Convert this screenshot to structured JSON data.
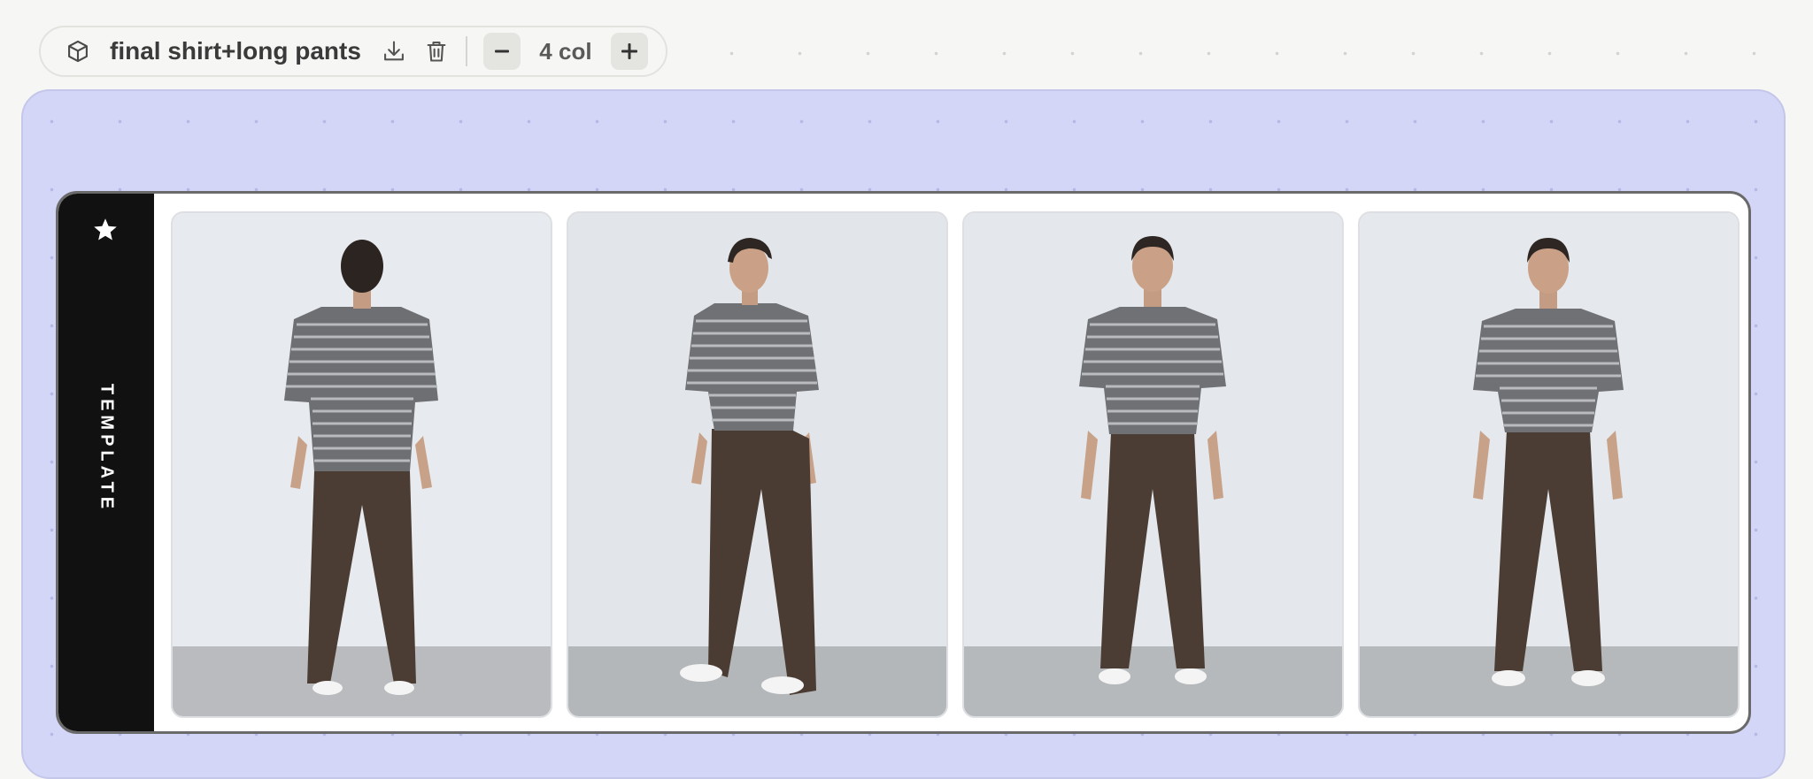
{
  "toolbar": {
    "title": "final shirt+long pants",
    "column_label": "4 col",
    "icons": {
      "board": "cube-icon",
      "download": "download-icon",
      "delete": "trash-icon",
      "decrease": "minus-icon",
      "increase": "plus-icon"
    }
  },
  "card": {
    "side_label": "TEMPLATE",
    "side_icon": "star-icon",
    "columns": 4,
    "photos": [
      {
        "view": "back"
      },
      {
        "view": "three-quarter left"
      },
      {
        "view": "front"
      },
      {
        "view": "front"
      }
    ]
  },
  "colors": {
    "page_background": "#f6f6f4",
    "board_background": "#d4d6f7",
    "side_strip": "#111111",
    "card_border": "#6a6a6a"
  }
}
